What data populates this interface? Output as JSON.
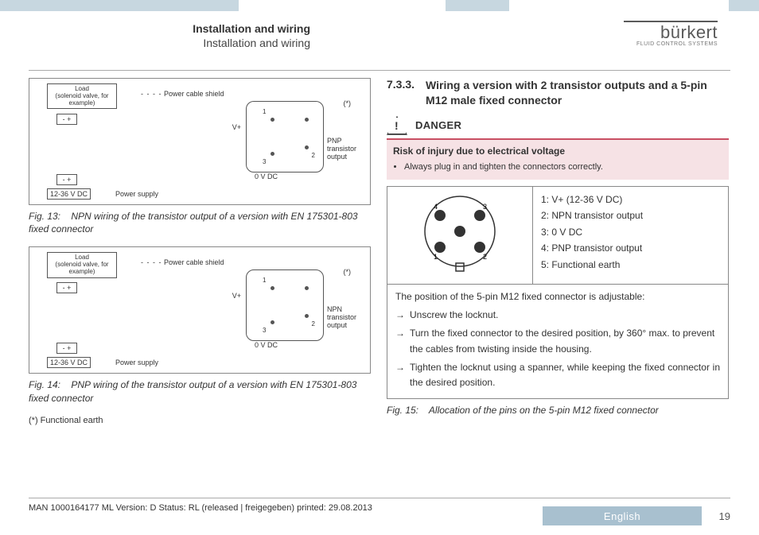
{
  "header": {
    "title_bold": "Installation and wiring",
    "title_sub": "Installation and wiring"
  },
  "logo": {
    "brand": "bürkert",
    "tag": "FLUID CONTROL SYSTEMS"
  },
  "left": {
    "fig13": {
      "labels": {
        "load": "Load",
        "load_sub": "(solenoid valve, for example)",
        "power_cable_shield": "Power cable shield",
        "asterisk": "(*)",
        "vplus": "V+",
        "zero": "0 V DC",
        "pnp_out": "PNP transistor output",
        "supply_range": "12-36 V DC",
        "power_supply": "Power supply",
        "pin1": "1",
        "pin2": "2",
        "pin3": "3"
      },
      "caption_no": "Fig. 13:",
      "caption_text": "NPN wiring of the transistor output of a version with EN 175301-803 fixed connector"
    },
    "fig14": {
      "labels": {
        "load": "Load",
        "load_sub": "(solenoid valve, for example)",
        "power_cable_shield": "Power cable shield",
        "asterisk": "(*)",
        "vplus": "V+",
        "zero": "0 V DC",
        "npn_out": "NPN transistor output",
        "supply_range": "12-36 V DC",
        "power_supply": "Power supply",
        "pin1": "1",
        "pin2": "2",
        "pin3": "3"
      },
      "caption_no": "Fig. 14:",
      "caption_text": "PNP wiring of the transistor output of a version with EN 175301-803 fixed connector"
    },
    "footnote": "(*) Functional earth"
  },
  "right": {
    "sect_num": "7.3.3.",
    "sect_title": "Wiring a version with 2 transistor outputs and a 5-pin M12 male fixed connector",
    "danger_word": "DANGER",
    "danger_risk": "Risk of injury due to electrical voltage",
    "danger_bullet": "Always plug in and tighten the connectors correctly.",
    "pins": {
      "p1": "1: V+ (12-36 V DC)",
      "p2": "2: NPN transistor output",
      "p3": "3: 0 V DC",
      "p4": "4: PNP transistor output",
      "p5": "5: Functional earth",
      "num1": "1",
      "num2": "2",
      "num3": "3",
      "num4": "4",
      "num5": "5"
    },
    "body_intro": "The position of the 5-pin M12 fixed connector is adjustable:",
    "step1": "Unscrew the locknut.",
    "step2": "Turn the fixed connector to the desired position, by 360° max. to prevent the cables from twisting inside the housing.",
    "step3": "Tighten the locknut using a spanner, while keeping the fixed connector in the desired position.",
    "arrow": "→",
    "fig15_no": "Fig. 15:",
    "fig15_text": "Allocation of the pins on the 5-pin M12 fixed connector"
  },
  "footer": {
    "docinfo": "MAN 1000164177 ML Version: D Status: RL (released | freigegeben) printed: 29.08.2013",
    "language": "English",
    "page": "19"
  }
}
